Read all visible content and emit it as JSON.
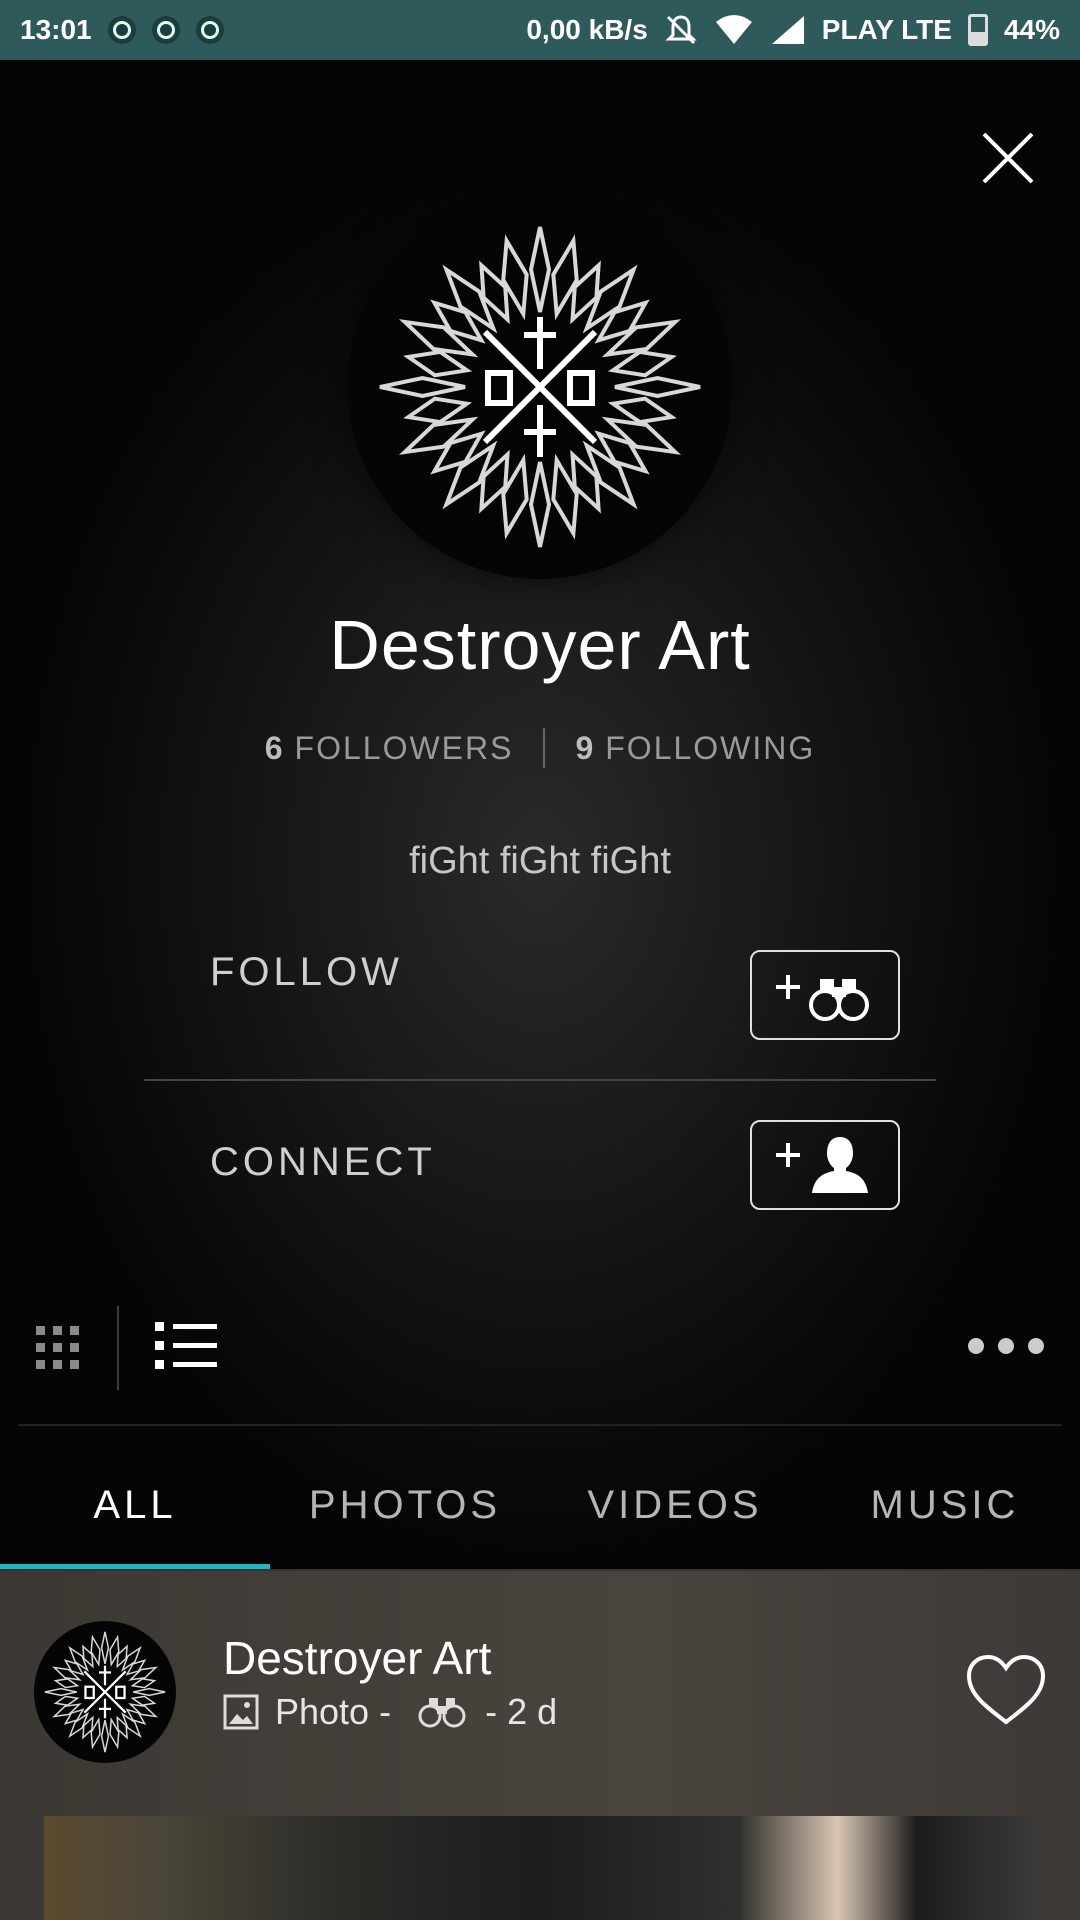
{
  "status_bar": {
    "time": "13:01",
    "net_speed": "0,00 kB/s",
    "carrier": "PLAY LTE",
    "battery": "44%",
    "battery_level": 0.44,
    "icons": [
      "notification-icon",
      "sync-icon",
      "upload-icon",
      "mute-icon",
      "wifi-icon",
      "signal-icon",
      "battery-icon"
    ]
  },
  "profile": {
    "name": "Destroyer Art",
    "followers_count": "6",
    "followers_label": "FOLLOWERS",
    "following_count": "9",
    "following_label": "FOLLOWING",
    "bio": "fiGht fiGht fiGht"
  },
  "actions": {
    "follow_label": "FOLLOW",
    "connect_label": "CONNECT"
  },
  "tabs": [
    "ALL",
    "PHOTOS",
    "VIDEOS",
    "MUSIC"
  ],
  "active_tab": "ALL",
  "accent_color": "#1fb7c4",
  "status_bar_color": "#2e5a5b",
  "feed": {
    "author": "Destroyer Art",
    "type": "Photo -",
    "time": "- 2 d"
  }
}
